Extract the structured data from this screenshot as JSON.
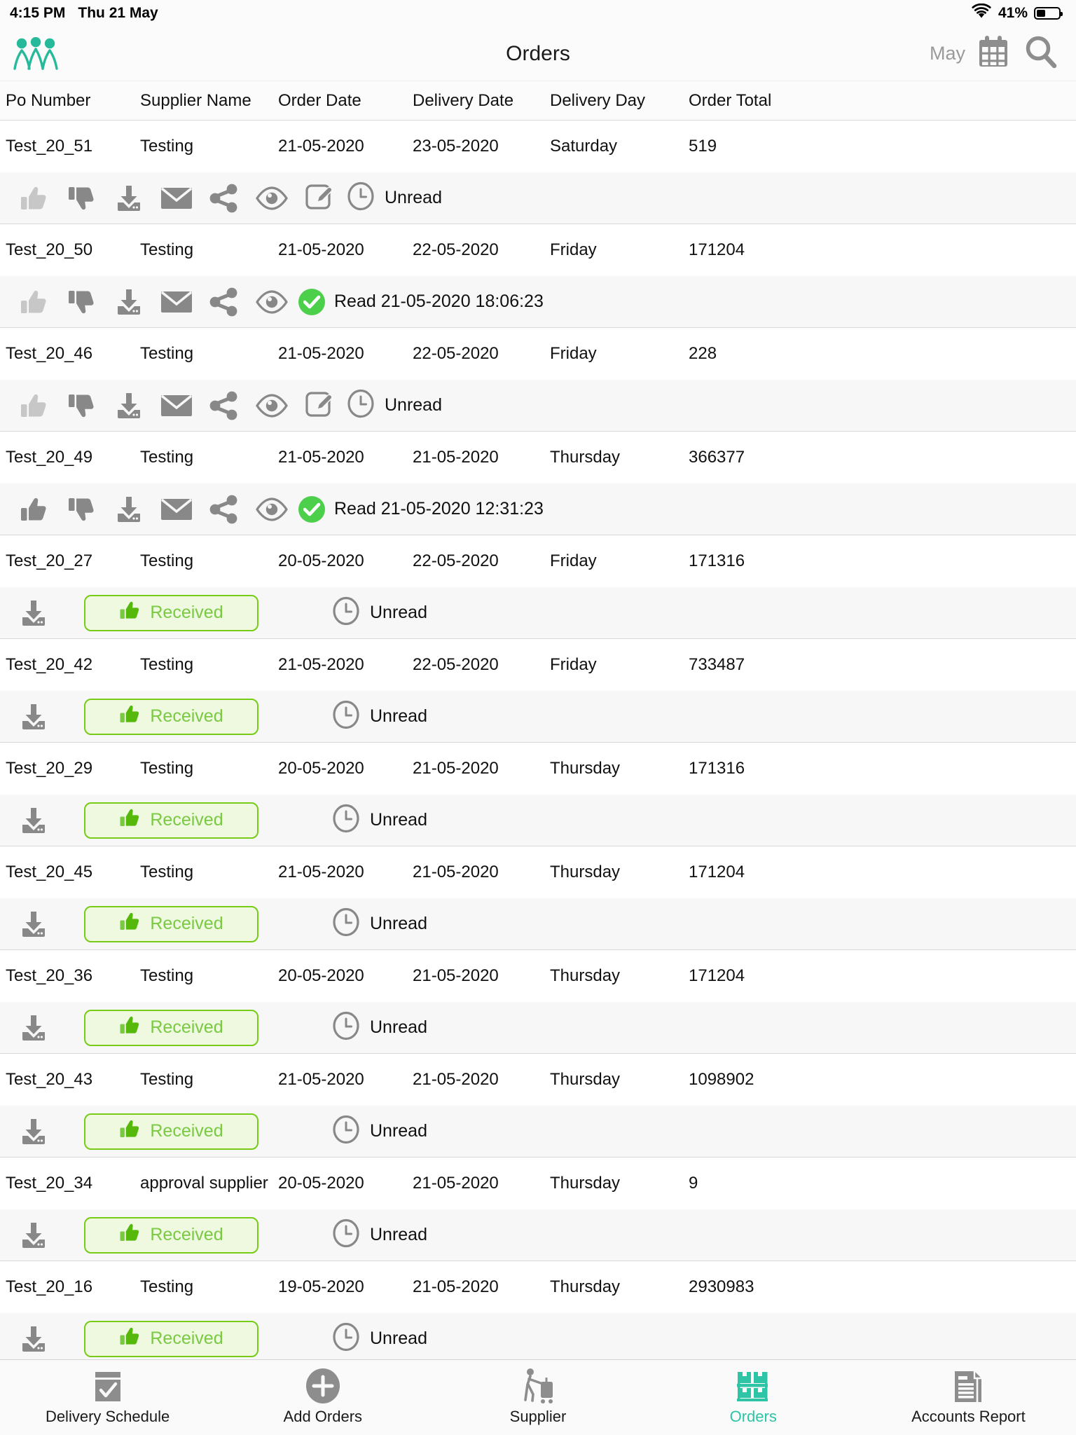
{
  "status_bar": {
    "time": "4:15 PM",
    "date": "Thu 21 May",
    "battery_percent": "41%",
    "wifi_icon": "wifi-icon",
    "battery_icon": "battery-icon"
  },
  "nav": {
    "title": "Orders",
    "month": "May",
    "logo_icon": "people-group-logo",
    "calendar_icon": "calendar-icon",
    "search_icon": "search-icon"
  },
  "table": {
    "columns": [
      "Po Number",
      "Supplier Name",
      "Order Date",
      "Delivery Date",
      "Delivery Day",
      "Order Total"
    ],
    "rows": [
      {
        "po": "Test_20_51",
        "supplier": "Testing",
        "order_date": "21-05-2020",
        "delivery_date": "23-05-2020",
        "delivery_day": "Saturday",
        "total": "519",
        "action_type": "icons",
        "status": "Unread",
        "status_icon": "clock-icon",
        "thumb_up_state": "light"
      },
      {
        "po": "Test_20_50",
        "supplier": "Testing",
        "order_date": "21-05-2020",
        "delivery_date": "22-05-2020",
        "delivery_day": "Friday",
        "total": "171204",
        "action_type": "icons-read",
        "status": "Read 21-05-2020 18:06:23",
        "status_icon": "check-circle-icon",
        "thumb_up_state": "light"
      },
      {
        "po": "Test_20_46",
        "supplier": "Testing",
        "order_date": "21-05-2020",
        "delivery_date": "22-05-2020",
        "delivery_day": "Friday",
        "total": "228",
        "action_type": "icons",
        "status": "Unread",
        "status_icon": "clock-icon",
        "thumb_up_state": "light"
      },
      {
        "po": "Test_20_49",
        "supplier": "Testing",
        "order_date": "21-05-2020",
        "delivery_date": "21-05-2020",
        "delivery_day": "Thursday",
        "total": "366377",
        "action_type": "icons-read",
        "status": "Read 21-05-2020 12:31:23",
        "status_icon": "check-circle-icon",
        "thumb_up_state": "dark"
      },
      {
        "po": "Test_20_27",
        "supplier": "Testing",
        "order_date": "20-05-2020",
        "delivery_date": "22-05-2020",
        "delivery_day": "Friday",
        "total": "171316",
        "action_type": "received",
        "received_label": "Received",
        "status": "Unread",
        "status_icon": "clock-icon"
      },
      {
        "po": "Test_20_42",
        "supplier": "Testing",
        "order_date": "21-05-2020",
        "delivery_date": "22-05-2020",
        "delivery_day": "Friday",
        "total": "733487",
        "action_type": "received",
        "received_label": "Received",
        "status": "Unread",
        "status_icon": "clock-icon"
      },
      {
        "po": "Test_20_29",
        "supplier": "Testing",
        "order_date": "20-05-2020",
        "delivery_date": "21-05-2020",
        "delivery_day": "Thursday",
        "total": "171316",
        "action_type": "received",
        "received_label": "Received",
        "status": "Unread",
        "status_icon": "clock-icon"
      },
      {
        "po": "Test_20_45",
        "supplier": "Testing",
        "order_date": "21-05-2020",
        "delivery_date": "21-05-2020",
        "delivery_day": "Thursday",
        "total": "171204",
        "action_type": "received",
        "received_label": "Received",
        "status": "Unread",
        "status_icon": "clock-icon"
      },
      {
        "po": "Test_20_36",
        "supplier": "Testing",
        "order_date": "20-05-2020",
        "delivery_date": "21-05-2020",
        "delivery_day": "Thursday",
        "total": "171204",
        "action_type": "received",
        "received_label": "Received",
        "status": "Unread",
        "status_icon": "clock-icon"
      },
      {
        "po": "Test_20_43",
        "supplier": "Testing",
        "order_date": "21-05-2020",
        "delivery_date": "21-05-2020",
        "delivery_day": "Thursday",
        "total": "1098902",
        "action_type": "received",
        "received_label": "Received",
        "status": "Unread",
        "status_icon": "clock-icon"
      },
      {
        "po": "Test_20_34",
        "supplier": "approval supplier",
        "order_date": "20-05-2020",
        "delivery_date": "21-05-2020",
        "delivery_day": "Thursday",
        "total": "9",
        "action_type": "received",
        "received_label": "Received",
        "status": "Unread",
        "status_icon": "clock-icon"
      },
      {
        "po": "Test_20_16",
        "supplier": "Testing",
        "order_date": "19-05-2020",
        "delivery_date": "21-05-2020",
        "delivery_day": "Thursday",
        "total": "2930983",
        "action_type": "received",
        "received_label": "Received",
        "status": "Unread",
        "status_icon": "clock-icon"
      }
    ]
  },
  "tabbar": {
    "items": [
      {
        "label": "Delivery Schedule",
        "icon": "calendar-check-icon",
        "active": false
      },
      {
        "label": "Add Orders",
        "icon": "plus-circle-icon",
        "active": false
      },
      {
        "label": "Supplier",
        "icon": "person-cart-icon",
        "active": false
      },
      {
        "label": "Orders",
        "icon": "shelf-boxes-icon",
        "active": true
      },
      {
        "label": "Accounts Report",
        "icon": "document-report-icon",
        "active": false
      }
    ]
  },
  "colors": {
    "accent_teal": "#2ec4a6",
    "received_green": "#7ac943",
    "received_border": "#76cc16",
    "received_bg": "#eef9e0",
    "read_green": "#4cd04c",
    "icon_gray": "#888888",
    "icon_gray_light": "#c7c7c7"
  }
}
